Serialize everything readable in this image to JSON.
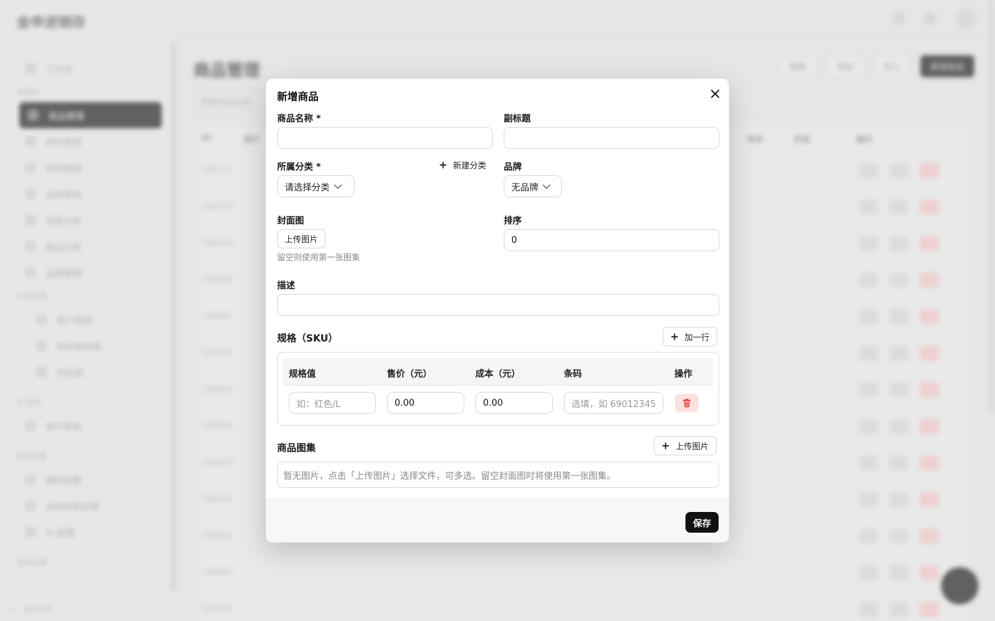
{
  "background": {
    "app_name": "金申进销存",
    "page_title": "商品管理",
    "search_placeholder": "搜索商品名称",
    "nav": [
      "工作台",
      "商品管理",
      "库存管理",
      "采购管理",
      "出库管理",
      "经营分析",
      "商品分类",
      "品牌管理",
      "客户档案",
      "供应商档案",
      "供应商",
      "供应商",
      "统计报表",
      "通知配置",
      "系统参数设置",
      "AI 配置"
    ],
    "nav_groups": [
      "进销存",
      "往来管理",
      "AI 助手",
      "系统设置",
      "系统设置"
    ],
    "footer": "返回主页",
    "actions": [
      "模板",
      "导出",
      "导入",
      "新增商品"
    ],
    "table_headers": [
      "ID",
      "图片",
      "库存",
      "状态",
      "操作"
    ],
    "row_ids": [
      "100271",
      "100270",
      "100269",
      "100268",
      "100267",
      "100266",
      "100265",
      "100264",
      "100263",
      "100262",
      "100261",
      "100001",
      "100002"
    ]
  },
  "modal": {
    "title": "新增商品",
    "fields": {
      "name_label": "商品名称 *",
      "subtitle_label": "副标题",
      "category_label": "所属分类 *",
      "new_category": "新建分类",
      "category_select": "请选择分类",
      "brand_label": "品牌",
      "brand_select": "无品牌",
      "cover_label": "封面图",
      "upload_label": "上传图片",
      "cover_hint": "留空则使用第一张图集",
      "sort_label": "排序",
      "sort_value": "0",
      "desc_label": "描述"
    },
    "sku": {
      "title": "规格（SKU）",
      "add_row": "加一行",
      "headers": [
        "规格值",
        "售价（元）",
        "成本（元）",
        "条码",
        "操作"
      ],
      "row": {
        "spec_placeholder": "如：红色/L",
        "price": "0.00",
        "cost": "0.00",
        "barcode_placeholder": "选填，如 69012345"
      }
    },
    "gallery": {
      "title": "商品图集",
      "upload": "上传图片",
      "empty": "暂无图片，点击「上传图片」选择文件，可多选。留空封面图时将使用第一张图集。"
    },
    "save": "保存"
  },
  "colors": {
    "primary": "#111111",
    "danger": "#e23b3b",
    "danger_bg": "#fde1e1"
  }
}
